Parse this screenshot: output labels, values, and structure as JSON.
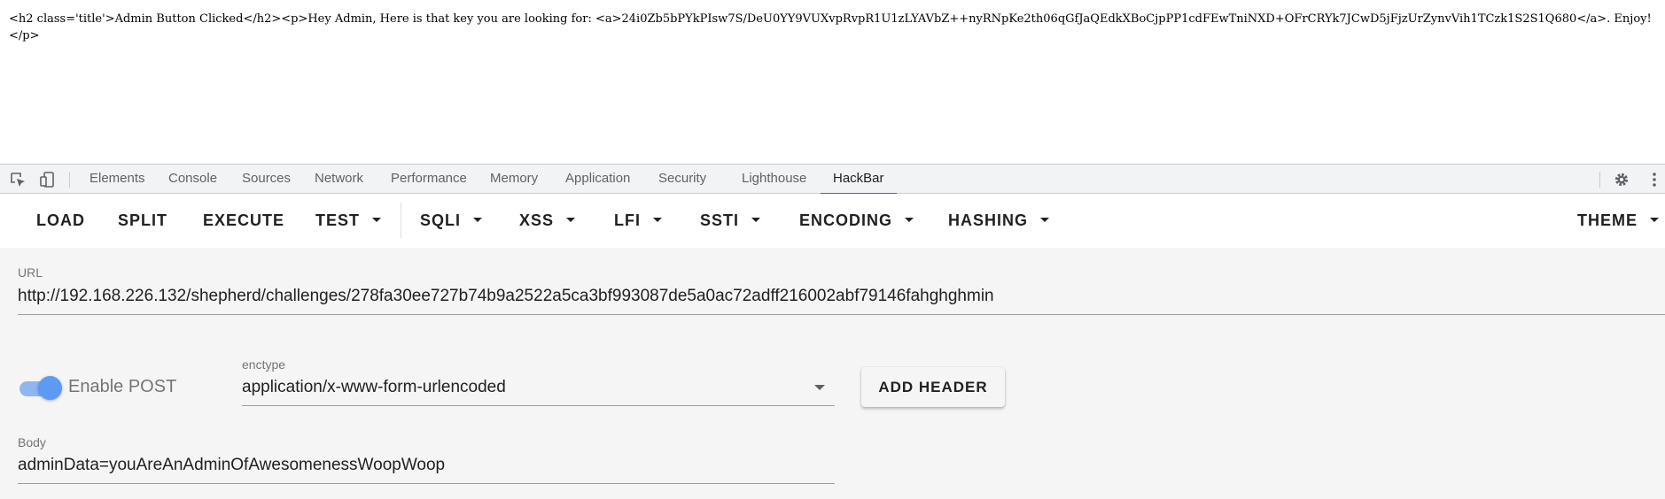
{
  "page_output": {
    "text": "<h2 class='title'>Admin Button Clicked</h2><p>Hey Admin, Here is that key you are looking for: <a>24i0Zb5bPYkPIsw7S/DeU0YY9VUXvpRvpR1U1zLYAVbZ++nyRNpKe2th06qGfJaQEdkXBoCjpPP1cdFEwTniNXD+OFrCRYk7JCwD5jFjzUrZynvVih1TCzk1S2S1Q680</a>. Enjoy!</p>"
  },
  "devtools": {
    "tabs": [
      {
        "label": "Elements"
      },
      {
        "label": "Console"
      },
      {
        "label": "Sources"
      },
      {
        "label": "Network"
      },
      {
        "label": "Performance"
      },
      {
        "label": "Memory"
      },
      {
        "label": "Application"
      },
      {
        "label": "Security"
      },
      {
        "label": "Lighthouse"
      },
      {
        "label": "HackBar"
      }
    ],
    "active_tab": "HackBar",
    "icons": [
      "inspect-element-icon",
      "device-toolbar-icon",
      "settings-gear-icon",
      "more-options-icon"
    ]
  },
  "hackbar": {
    "toolbar": {
      "load": "LOAD",
      "split": "SPLIT",
      "execute": "EXECUTE",
      "test": "TEST",
      "sqli": "SQLI",
      "xss": "XSS",
      "lfi": "LFI",
      "ssti": "SSTI",
      "encoding": "ENCODING",
      "hashing": "HASHING",
      "theme": "THEME"
    },
    "url": {
      "label": "URL",
      "value": "http://192.168.226.132/shepherd/challenges/278fa30ee727b74b9a2522a5ca3bf993087de5a0ac72adff216002abf79146fahghghmin"
    },
    "enable_post": {
      "label": "Enable POST",
      "checked": true
    },
    "enctype": {
      "label": "enctype",
      "value": "application/x-www-form-urlencoded"
    },
    "add_header_label": "ADD HEADER",
    "body": {
      "label": "Body",
      "value": "adminData=youAreAnAdminOfAwesomenessWoopWoop"
    }
  },
  "colors": {
    "accent": "#1a73e8",
    "switch": "#5d9af5"
  }
}
